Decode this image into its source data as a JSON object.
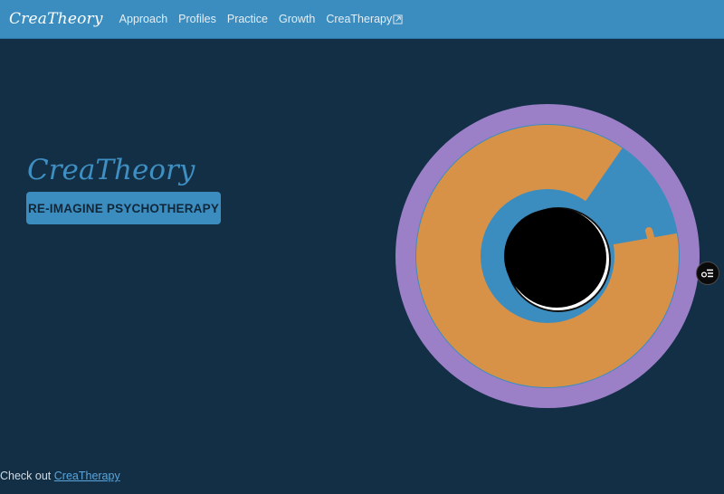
{
  "navbar": {
    "brand": "CreaTheory",
    "links": [
      {
        "label": "Approach"
      },
      {
        "label": "Profiles"
      },
      {
        "label": "Practice"
      },
      {
        "label": "Growth"
      },
      {
        "label": "CreaTherapy",
        "icon": "external-link-icon"
      }
    ]
  },
  "hero": {
    "title": "CreaTheory",
    "button_label": "RE-IMAGINE PSYCHOTHERAPY"
  },
  "logo": {
    "outer_ring_color": "#9b80c8",
    "middle_ring_color": "#3c8dbf",
    "brush_color": "#d89248",
    "core_color": "#000000",
    "crescent_color": "#ffffff"
  },
  "side_toggle": {
    "icon": "menu-list-icon"
  },
  "footer": {
    "prefix": "Check out",
    "link_label": "CreaTherapy"
  },
  "colors": {
    "background": "#122f45",
    "navbar": "#3c8dbf",
    "accent": "#3f8fc2"
  }
}
